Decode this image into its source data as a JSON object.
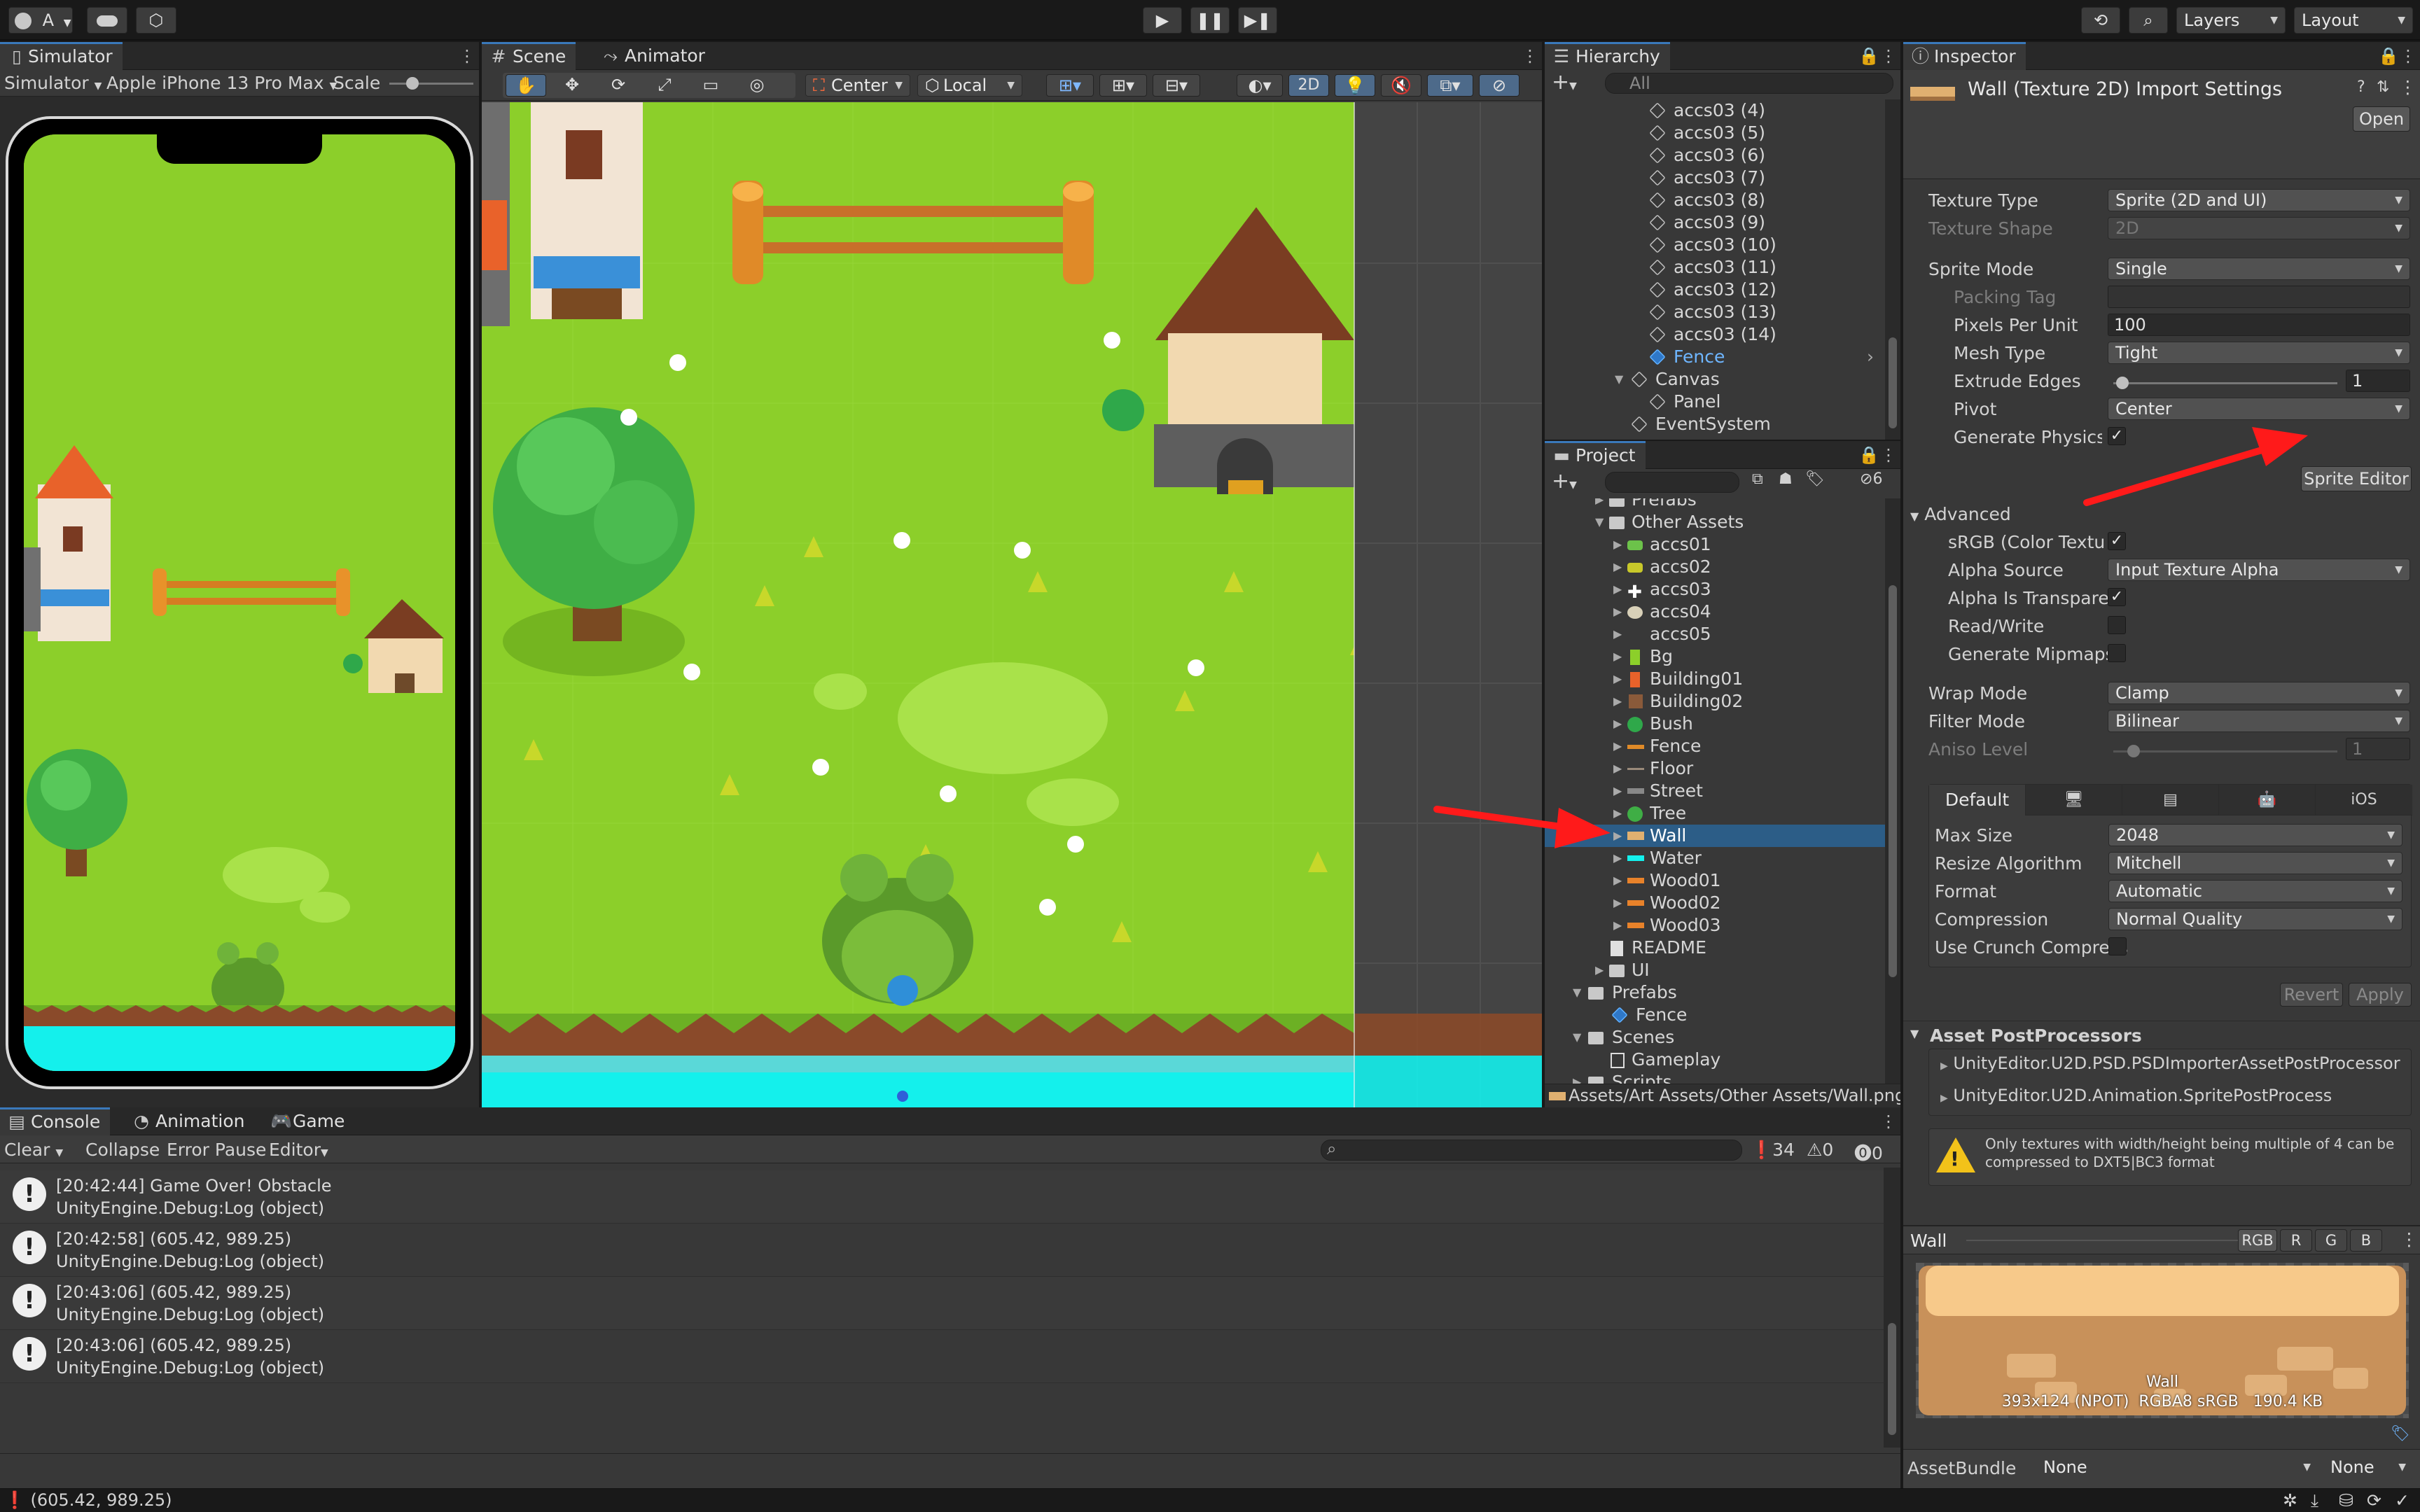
{
  "toolbar": {
    "account": "A",
    "layers": "Layers",
    "layout": "Layout"
  },
  "simulator": {
    "tab": "Simulator",
    "mode": "Simulator",
    "device": "Apple iPhone 13 Pro Max",
    "scale_label": "Scale"
  },
  "scene": {
    "tab_scene": "Scene",
    "tab_animator": "Animator",
    "pivot": "Center",
    "space": "Local",
    "mode_2d": "2D"
  },
  "hierarchy": {
    "tab": "Hierarchy",
    "search_placeholder": "All",
    "items": [
      {
        "label": "accs03 (4)"
      },
      {
        "label": "accs03 (5)"
      },
      {
        "label": "accs03 (6)"
      },
      {
        "label": "accs03 (7)"
      },
      {
        "label": "accs03 (8)"
      },
      {
        "label": "accs03 (9)"
      },
      {
        "label": "accs03 (10)"
      },
      {
        "label": "accs03 (11)"
      },
      {
        "label": "accs03 (12)"
      },
      {
        "label": "accs03 (13)"
      },
      {
        "label": "accs03 (14)"
      },
      {
        "label": "Fence"
      },
      {
        "label": "Canvas"
      },
      {
        "label": "Panel"
      },
      {
        "label": "EventSystem"
      }
    ]
  },
  "project": {
    "tab": "Project",
    "hidden_count": "6",
    "items": [
      {
        "label": "Prefabs"
      },
      {
        "label": "Other Assets"
      },
      {
        "label": "accs01"
      },
      {
        "label": "accs02"
      },
      {
        "label": "accs03"
      },
      {
        "label": "accs04"
      },
      {
        "label": "accs05"
      },
      {
        "label": "Bg"
      },
      {
        "label": "Building01"
      },
      {
        "label": "Building02"
      },
      {
        "label": "Bush"
      },
      {
        "label": "Fence"
      },
      {
        "label": "Floor"
      },
      {
        "label": "Street"
      },
      {
        "label": "Tree"
      },
      {
        "label": "Wall"
      },
      {
        "label": "Water"
      },
      {
        "label": "Wood01"
      },
      {
        "label": "Wood02"
      },
      {
        "label": "Wood03"
      },
      {
        "label": "README"
      },
      {
        "label": "UI"
      },
      {
        "label": "Prefabs"
      },
      {
        "label": "Fence"
      },
      {
        "label": "Scenes"
      },
      {
        "label": "Gameplay"
      },
      {
        "label": "Scripts"
      }
    ],
    "path": "Assets/Art Assets/Other Assets/Wall.png"
  },
  "inspector": {
    "tab": "Inspector",
    "title": "Wall (Texture 2D) Import Settings",
    "open_button": "Open",
    "props": {
      "texture_type": {
        "label": "Texture Type",
        "value": "Sprite (2D and UI)"
      },
      "texture_shape": {
        "label": "Texture Shape",
        "value": "2D"
      },
      "sprite_mode": {
        "label": "Sprite Mode",
        "value": "Single"
      },
      "packing_tag": {
        "label": "Packing Tag",
        "value": ""
      },
      "ppu": {
        "label": "Pixels Per Unit",
        "value": "100"
      },
      "mesh_type": {
        "label": "Mesh Type",
        "value": "Tight"
      },
      "extrude": {
        "label": "Extrude Edges",
        "value": "1"
      },
      "pivot": {
        "label": "Pivot",
        "value": "Center"
      },
      "gen_physics": {
        "label": "Generate Physics S"
      },
      "srgb": {
        "label": "sRGB (Color Textu"
      },
      "alpha_source": {
        "label": "Alpha Source",
        "value": "Input Texture Alpha"
      },
      "alpha_transp": {
        "label": "Alpha Is Transparen"
      },
      "read_write": {
        "label": "Read/Write"
      },
      "mipmaps": {
        "label": "Generate Mipmaps"
      },
      "wrap_mode": {
        "label": "Wrap Mode",
        "value": "Clamp"
      },
      "filter_mode": {
        "label": "Filter Mode",
        "value": "Bilinear"
      },
      "aniso": {
        "label": "Aniso Level",
        "value": "1"
      }
    },
    "sprite_editor_button": "Sprite Editor",
    "advanced_header": "Advanced",
    "platform_tabs": [
      "Default",
      "",
      "",
      "",
      "iOS"
    ],
    "platform": {
      "max_size": {
        "label": "Max Size",
        "value": "2048"
      },
      "resize": {
        "label": "Resize Algorithm",
        "value": "Mitchell"
      },
      "format": {
        "label": "Format",
        "value": "Automatic"
      },
      "compression": {
        "label": "Compression",
        "value": "Normal Quality"
      },
      "crunch": {
        "label": "Use Crunch Compress"
      }
    },
    "revert_button": "Revert",
    "apply_button": "Apply",
    "postprocessors_header": "Asset PostProcessors",
    "postprocessors": [
      "UnityEditor.U2D.PSD.PSDImporterAssetPostProcessor",
      "UnityEditor.U2D.Animation.SpritePostProcess"
    ],
    "warning": "Only textures with width/height being multiple of 4 can be compressed to DXT5|BC3 format",
    "preview": {
      "name": "Wall",
      "channels": [
        "RGB",
        "R",
        "G",
        "B"
      ],
      "caption_name": "Wall",
      "caption_info": "393x124 (NPOT)  RGBA8 sRGB   190.4 KB"
    },
    "assetbundle": {
      "label": "AssetBundle",
      "value": "None",
      "variant": "None"
    }
  },
  "console": {
    "tabs": [
      "Console",
      "Animation",
      "Game"
    ],
    "clear": "Clear",
    "collapse": "Collapse",
    "error_pause": "Error Pause",
    "editor": "Editor",
    "count_info": "34",
    "count_warn": "0",
    "count_error": "0",
    "logs": [
      {
        "line1": "[20:42:44] Game Over! Obstacle",
        "line2": "UnityEngine.Debug:Log (object)"
      },
      {
        "line1": "[20:42:58] (605.42, 989.25)",
        "line2": "UnityEngine.Debug:Log (object)"
      },
      {
        "line1": "[20:43:06] (605.42, 989.25)",
        "line2": "UnityEngine.Debug:Log (object)"
      },
      {
        "line1": "[20:43:06] (605.42, 989.25)",
        "line2": "UnityEngine.Debug:Log (object)"
      }
    ]
  },
  "status": {
    "text": "(605.42, 989.25)"
  },
  "colors": {
    "accent": "#3a79bb",
    "selection": "#2c5d87",
    "arrow": "#ff1a1a",
    "grass": "#8ccf2a",
    "water": "#14f0ec"
  }
}
